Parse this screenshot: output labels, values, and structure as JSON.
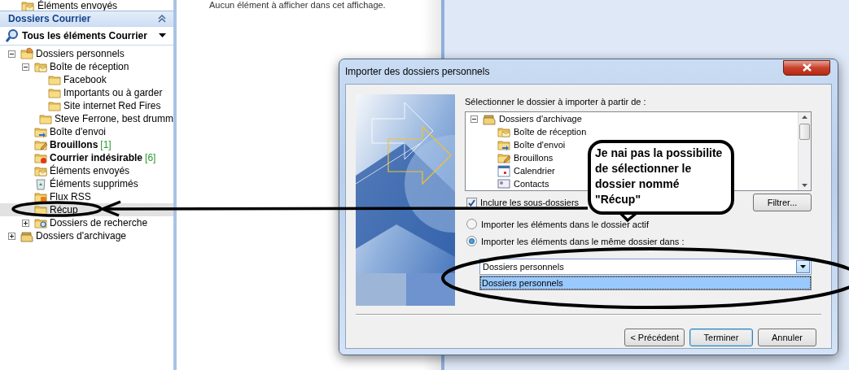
{
  "mail_pane": {
    "top_item": "Éléments envoyés",
    "header": "Dossiers Courrier",
    "view_selector": "Tous les éléments Courrier",
    "tree": [
      {
        "label": "Dossiers personnels",
        "kind": "personal",
        "unread": false,
        "selected": false,
        "expanded": true,
        "children": [
          {
            "label": "Boîte de réception",
            "kind": "inbox",
            "unread": false,
            "selected": false,
            "expanded": true,
            "children": [
              {
                "label": "Facebook",
                "kind": "folder",
                "unread": false,
                "selected": false
              },
              {
                "label": "Importants ou à garder",
                "kind": "folder",
                "unread": false,
                "selected": false
              },
              {
                "label": "Site internet Red Fires",
                "kind": "folder",
                "unread": false,
                "selected": false
              },
              {
                "label": "Steve Ferrone, best drumm",
                "kind": "folder",
                "unread": false,
                "selected": false
              }
            ]
          },
          {
            "label": "Boîte d'envoi",
            "kind": "outbox",
            "unread": false,
            "selected": false
          },
          {
            "label": "Brouillons",
            "kind": "drafts",
            "unread": true,
            "selected": false,
            "count": "[1]"
          },
          {
            "label": "Courrier indésirable",
            "kind": "junk",
            "unread": true,
            "selected": false,
            "count": "[6]"
          },
          {
            "label": "Éléments envoyés",
            "kind": "sent",
            "unread": false,
            "selected": false
          },
          {
            "label": "Éléments supprimés",
            "kind": "trash",
            "unread": false,
            "selected": false
          },
          {
            "label": "Flux RSS",
            "kind": "rss",
            "unread": false,
            "selected": false
          },
          {
            "label": "Récup",
            "kind": "folder",
            "unread": false,
            "selected": true
          },
          {
            "label": "Dossiers de recherche",
            "kind": "search",
            "unread": false,
            "selected": false,
            "expanded": false
          }
        ]
      },
      {
        "label": "Dossiers d'archivage",
        "kind": "archive",
        "unread": false,
        "selected": false,
        "expanded": false
      }
    ]
  },
  "content_pane": {
    "message": "Aucun élément à afficher dans cet affichage."
  },
  "dialog": {
    "title": "Importer des dossiers personnels",
    "folder_label": "Sélectionner le dossier à importer à partir de :",
    "folders": [
      {
        "label": "Dossiers d'archivage",
        "kind": "archive",
        "expanded": true,
        "children": [
          {
            "label": "Boîte de réception",
            "kind": "inbox"
          },
          {
            "label": "Boîte d'envoi",
            "kind": "outbox"
          },
          {
            "label": "Brouillons",
            "kind": "drafts"
          },
          {
            "label": "Calendrier",
            "kind": "calendar"
          },
          {
            "label": "Contacts",
            "kind": "contacts"
          }
        ]
      }
    ],
    "include_subfolders": {
      "label": "Inclure les sous-dossiers",
      "checked": true
    },
    "filter_button": "Filtrer...",
    "import_options": [
      {
        "label": "Importer les éléments dans le dossier actif",
        "selected": false
      },
      {
        "label": "Importer les éléments dans le même dossier dans :",
        "selected": true
      }
    ],
    "target_folder": {
      "value": "Dossiers personnels",
      "options": [
        {
          "label": "Dossiers personnels",
          "selected": true
        }
      ]
    },
    "buttons": [
      {
        "label": "< Précédent",
        "default": false
      },
      {
        "label": "Terminer",
        "default": true
      },
      {
        "label": "Annuler",
        "default": false
      }
    ]
  },
  "annotation": {
    "text": "Je nai pas la possibilite de sélectionner le dossier nommé \"Récup\""
  }
}
